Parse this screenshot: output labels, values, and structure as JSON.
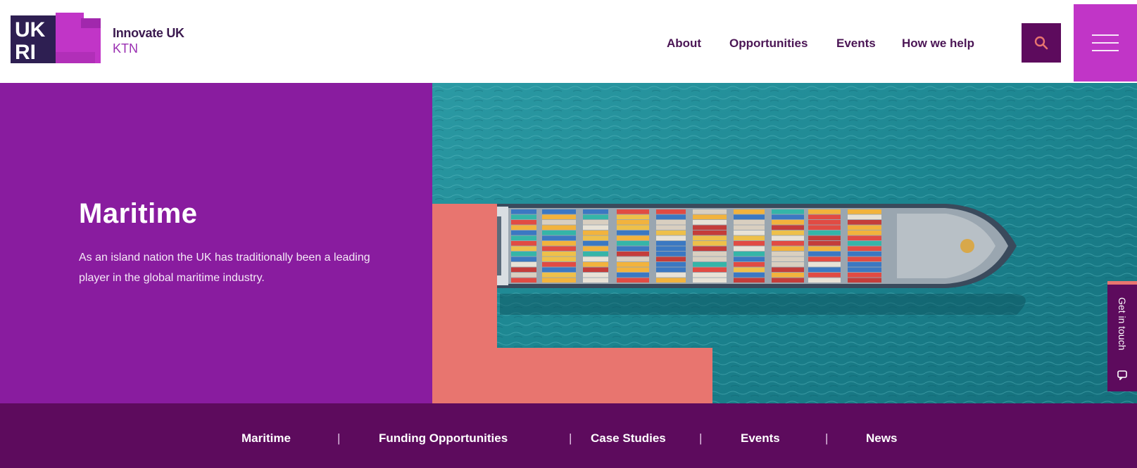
{
  "header": {
    "logo_text": "UKRI",
    "brand_name": "Innovate UK",
    "brand_sub": "KTN",
    "nav": [
      {
        "label": "About"
      },
      {
        "label": "Opportunities"
      },
      {
        "label": "Events"
      },
      {
        "label": "How we help"
      }
    ],
    "search_icon": "search-icon",
    "menu_icon": "hamburger-menu-icon"
  },
  "hero": {
    "title": "Maritime",
    "description": "As an island nation the UK has traditionally been a leading player in the global maritime industry.",
    "image": "aerial view of container ship on ocean"
  },
  "get_in_touch": {
    "label": "Get in touch",
    "icon": "chat-bubble-icon"
  },
  "subnav": {
    "items": [
      {
        "label": "Maritime"
      },
      {
        "label": "Funding Opportunities"
      },
      {
        "label": "Case Studies"
      },
      {
        "label": "Events"
      },
      {
        "label": "News"
      }
    ],
    "separator": "|"
  },
  "colors": {
    "purple": "#891c9f",
    "dark_purple": "#5d0b5d",
    "magenta": "#c135c7",
    "coral": "#e8756f",
    "sea": "#1e8a96"
  }
}
